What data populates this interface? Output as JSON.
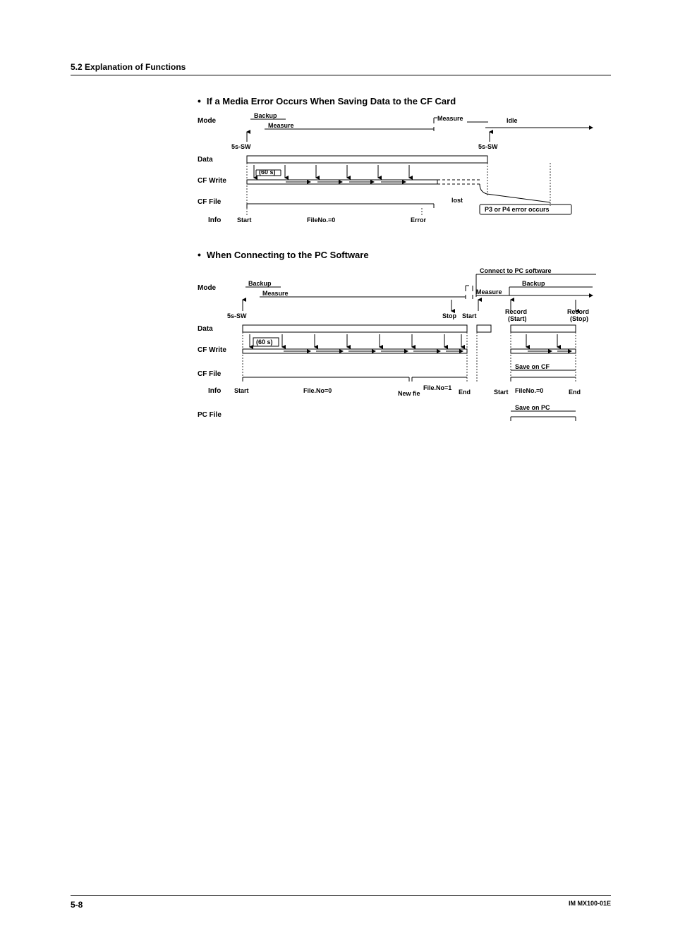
{
  "section_header": "5.2  Explanation of Functions",
  "bullet1": "If a Media Error Occurs When Saving Data to the CF Card",
  "bullet2": "When Connecting to the PC Software",
  "rows": {
    "mode": "Mode",
    "data": "Data",
    "cfwrite": "CF Write",
    "cffile": "CF File",
    "info": "Info",
    "pcfile": "PC File"
  },
  "d1": {
    "backup": "Backup",
    "measure": "Measure",
    "measure2": "Measure",
    "idle": "Idle",
    "sw1": "5s-SW",
    "sw2": "5s-SW",
    "sixty": "(60 s)",
    "lost": "lost",
    "error_box": "P3 or P4 error occurs",
    "start": "Start",
    "fileno": "FileNo.=0",
    "error": "Error"
  },
  "d2": {
    "connect": "Connect to PC software",
    "backup": "Backup",
    "measure": "Measure",
    "measure2": "Measure",
    "backup2": "Backup",
    "sw": "5s-SW",
    "stop": "Stop",
    "start2": "Start",
    "record_start": "Record\n(Start)",
    "record_stop": "Record\n(Stop)",
    "sixty": "(60 s)",
    "save_cf": "Save on CF",
    "start": "Start",
    "fileno0": "File.No=0",
    "newfie": "New fie",
    "fileno1": "File.No=1",
    "end": "End",
    "start3": "Start",
    "fileno0b": "FileNo.=0",
    "end2": "End",
    "save_pc": "Save on PC"
  },
  "footer": {
    "page": "5-8",
    "doc": "IM MX100-01E"
  }
}
